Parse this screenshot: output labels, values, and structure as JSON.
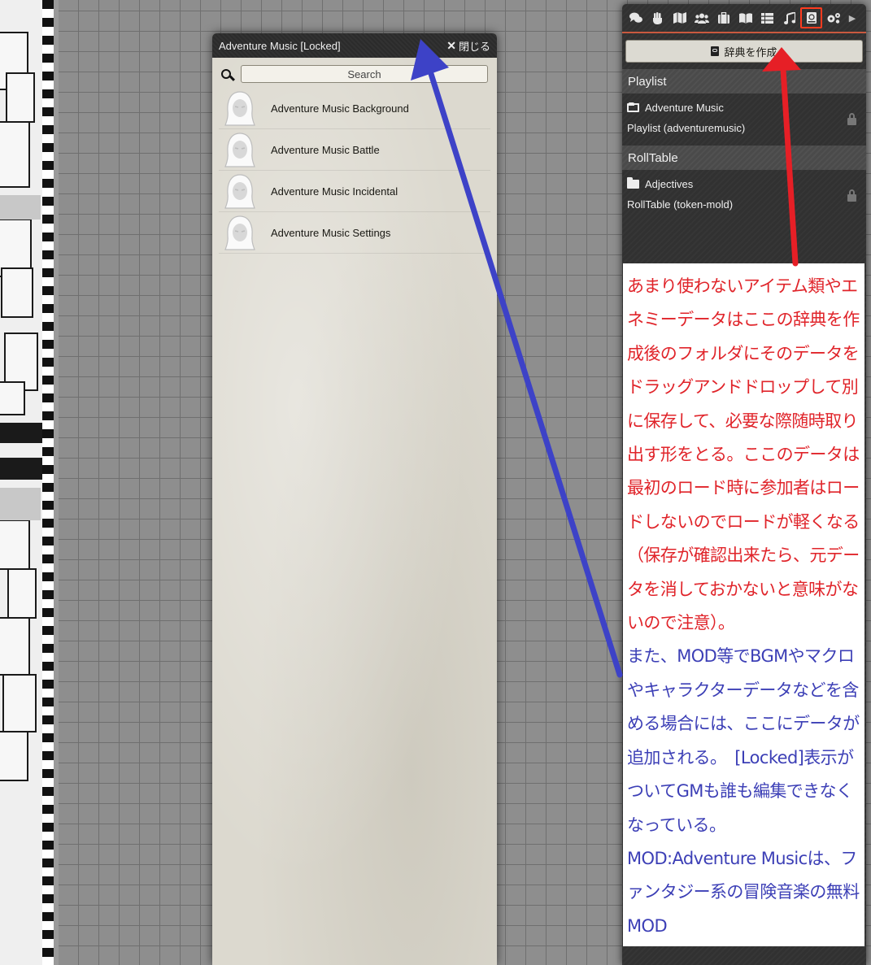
{
  "compendium_window": {
    "title": "Adventure Music [Locked]",
    "close_label": "閉じる",
    "search_placeholder": "Search",
    "items": [
      {
        "label": "Adventure Music Background",
        "icon": "hooded-figure-icon"
      },
      {
        "label": "Adventure Music Battle",
        "icon": "hooded-figure-icon"
      },
      {
        "label": "Adventure Music Incidental",
        "icon": "hooded-figure-icon"
      },
      {
        "label": "Adventure Music Settings",
        "icon": "hooded-figure-icon"
      }
    ]
  },
  "sidebar": {
    "tabs": [
      {
        "name": "chat-tab",
        "icon": "comments-icon"
      },
      {
        "name": "combat-tab",
        "icon": "fist-icon"
      },
      {
        "name": "scenes-tab",
        "icon": "map-icon"
      },
      {
        "name": "actors-tab",
        "icon": "users-icon"
      },
      {
        "name": "items-tab",
        "icon": "suitcase-icon"
      },
      {
        "name": "journal-tab",
        "icon": "book-open-icon"
      },
      {
        "name": "tables-tab",
        "icon": "th-list-icon"
      },
      {
        "name": "playlists-tab",
        "icon": "music-icon"
      },
      {
        "name": "compendium-tab",
        "icon": "atlas-icon",
        "active": true
      },
      {
        "name": "settings-tab",
        "icon": "cogs-icon"
      }
    ],
    "create_button_label": "辞典を作成",
    "sections": [
      {
        "header": "Playlist",
        "packs": [
          {
            "title": "Adventure Music",
            "subtitle": "Playlist (adventuremusic)",
            "folder_open": true,
            "locked": true
          }
        ]
      },
      {
        "header": "RollTable",
        "packs": [
          {
            "title": "Adjectives",
            "subtitle": "RollTable (token-mold)",
            "folder_open": false,
            "locked": true
          }
        ]
      }
    ]
  },
  "annotation": {
    "red_text": "あまり使わないアイテム類やエネミーデータはここの辞典を作成後のフォルダにそのデータをドラッグアンドドロップして別に保存して、必要な際随時取り出す形をとる。ここのデータは最初のロード時に参加者はロードしないのでロードが軽くなる（保存が確認出来たら、元データを消しておかないと意味がないので注意）。",
    "blue_text_1": "また、MOD等でBGMやマクロやキャラクターデータなどを含める場合には、ここにデータが追加される。　[Locked]表示がついてGMも誰も編集できなくなっている。",
    "blue_text_2": "MOD:Adventure Musicは、ファンタジー系の冒険音楽の無料MOD",
    "red_color": "#e0242a",
    "blue_color": "#3c3fb6"
  }
}
